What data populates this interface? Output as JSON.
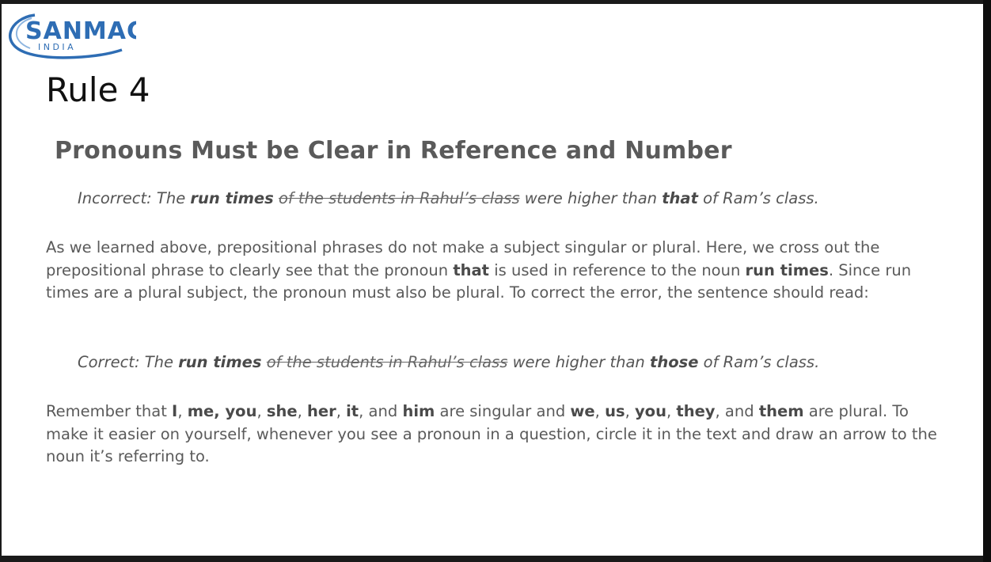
{
  "logo": {
    "brand": "SANMACS",
    "subtitle": "I N D I A",
    "brand_color": "#2e6db4"
  },
  "title": "Rule 4",
  "heading": "Pronouns Must be Clear in Reference and Number",
  "incorrect": {
    "prefix": "Incorrect: The ",
    "subject": "run times",
    "struck": "of the students in Rahul’s class",
    "mid": " were higher than ",
    "pronoun": "that",
    "suffix": " of Ram’s class."
  },
  "explanation": {
    "t1": "As we learned above, prepositional phrases do not make a subject singular or plural. Here, we cross out the prepositional phrase to clearly see that the pronoun ",
    "b1": "that",
    "t2": " is used in reference to the noun ",
    "b2": "run times",
    "t3": ". Since run times are a plural subject, the pronoun must also be plural. To correct the error, the sentence should read:"
  },
  "correct": {
    "prefix": "Correct: The ",
    "subject": "run times",
    "struck": "of the students in Rahul’s class",
    "mid": " were higher than ",
    "pronoun": "those",
    "suffix": " of Ram’s class."
  },
  "remember": {
    "t0": "Remember that ",
    "p1": "I",
    "s1": ", ",
    "p2": "me, you",
    "s2": ", ",
    "p3": "she",
    "s3": ", ",
    "p4": "her",
    "s4": ", ",
    "p5": "it",
    "s5": ", and ",
    "p6": "him",
    "s6": " are singular and ",
    "p7": "we",
    "s7": ", ",
    "p8": "us",
    "s8": ", ",
    "p9": "you",
    "s9": ", ",
    "p10": "they",
    "s10": ", and ",
    "p11": "them",
    "t_end": " are plural. To make it easier on yourself, whenever you see a pronoun in a question, circle it in the text and draw an arrow to the noun it’s referring to."
  }
}
